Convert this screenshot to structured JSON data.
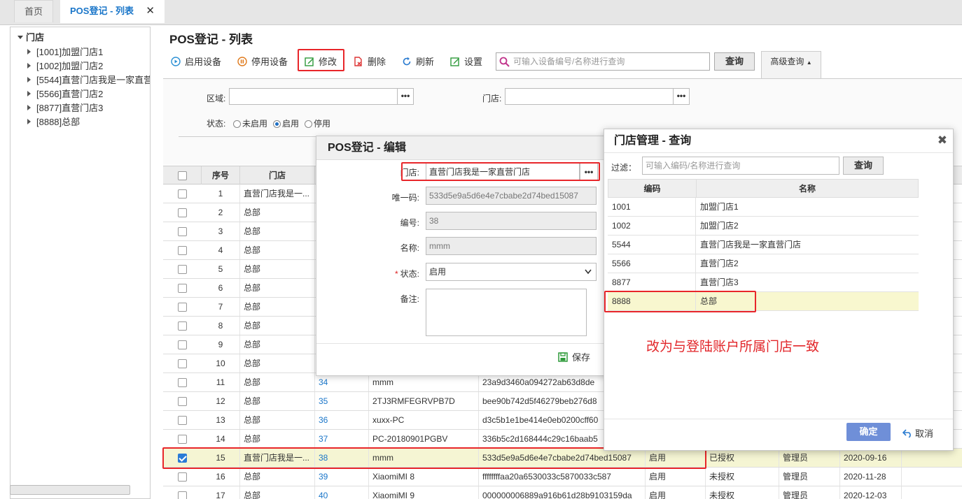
{
  "tabs": {
    "home": "首页",
    "list": "POS登记 - 列表",
    "close": "✕"
  },
  "sidebar": {
    "root": "门店",
    "items": [
      {
        "label": "[1001]加盟门店1"
      },
      {
        "label": "[1002]加盟门店2"
      },
      {
        "label": "[5544]直营门店我是一家直营门店"
      },
      {
        "label": "[5566]直营门店2"
      },
      {
        "label": "[8877]直营门店3"
      },
      {
        "label": "[8888]总部"
      }
    ]
  },
  "page": {
    "title": "POS登记 - 列表"
  },
  "toolbar": {
    "enable": "启用设备",
    "disable": "停用设备",
    "edit": "修改",
    "delete": "删除",
    "refresh": "刷新",
    "settings": "设置",
    "search_placeholder": "可输入设备编号/名称进行查询",
    "search": "查询",
    "advanced": "高级查询"
  },
  "filters": {
    "area_label": "区域:",
    "store_label": "门店:",
    "dots": "•••",
    "status_label": "状态:",
    "status_options": [
      "未启用",
      "启用",
      "停用"
    ]
  },
  "table": {
    "headers": [
      "序号",
      "门店"
    ],
    "rows": [
      {
        "no": "1",
        "store": "直营门店我是一...",
        "id": "",
        "name": "",
        "uid": "",
        "status": "",
        "auth": "",
        "user": "",
        "date": ""
      },
      {
        "no": "2",
        "store": "总部"
      },
      {
        "no": "3",
        "store": "总部"
      },
      {
        "no": "4",
        "store": "总部"
      },
      {
        "no": "5",
        "store": "总部"
      },
      {
        "no": "6",
        "store": "总部"
      },
      {
        "no": "7",
        "store": "总部"
      },
      {
        "no": "8",
        "store": "总部"
      },
      {
        "no": "9",
        "store": "总部"
      },
      {
        "no": "10",
        "store": "总部"
      },
      {
        "no": "11",
        "store": "总部",
        "id": "34",
        "name": "mmm",
        "uid": "23a9d3460a094272ab63d8de"
      },
      {
        "no": "12",
        "store": "总部",
        "id": "35",
        "name": "2TJ3RMFEGRVPB7D",
        "uid": "bee90b742d5f46279beb276d8"
      },
      {
        "no": "13",
        "store": "总部",
        "id": "36",
        "name": "xuxx-PC",
        "uid": "d3c5b1e1be414e0eb0200cff60"
      },
      {
        "no": "14",
        "store": "总部",
        "id": "37",
        "name": "PC-20180901PGBV",
        "uid": "336b5c2d168444c29c16baab5"
      },
      {
        "no": "15",
        "store": "直营门店我是一...",
        "id": "38",
        "name": "mmm",
        "uid": "533d5e9a5d6e4e7cbabe2d74bed15087",
        "status": "启用",
        "auth": "已授权",
        "user": "管理员",
        "date": "2020-09-16"
      },
      {
        "no": "16",
        "store": "总部",
        "id": "39",
        "name": "XiaomiMI 8",
        "uid": "ffffffffaa20a6530033c5870033c587",
        "status": "启用",
        "auth": "未授权",
        "user": "管理员",
        "date": "2020-11-28"
      },
      {
        "no": "17",
        "store": "总部",
        "id": "40",
        "name": "XiaomiMI 9",
        "uid": "000000006889a916b61d28b9103159da",
        "status": "启用",
        "auth": "未授权",
        "user": "管理员",
        "date": "2020-12-03"
      }
    ]
  },
  "edit_dialog": {
    "title": "POS登记 - 编辑",
    "store_label": "门店:",
    "store_value": "直营门店我是一家直营门店",
    "uid_label": "唯一码:",
    "uid_value": "533d5e9a5d6e4e7cbabe2d74bed15087",
    "no_label": "编号:",
    "no_value": "38",
    "name_label": "名称:",
    "name_value": "mmm",
    "status_label": "状态:",
    "status_value": "启用",
    "remark_label": "备注:",
    "save": "保存",
    "required": "*"
  },
  "lookup_dialog": {
    "title": "门店管理 - 查询",
    "close": "✖",
    "filter_label": "过滤：",
    "filter_placeholder": "可输入编码/名称进行查询",
    "search": "查询",
    "col_code": "编码",
    "col_name": "名称",
    "rows": [
      {
        "code": "1001",
        "name": "加盟门店1"
      },
      {
        "code": "1002",
        "name": "加盟门店2"
      },
      {
        "code": "5544",
        "name": "直营门店我是一家直营门店"
      },
      {
        "code": "5566",
        "name": "直营门店2"
      },
      {
        "code": "8877",
        "name": "直营门店3"
      },
      {
        "code": "8888",
        "name": "总部"
      }
    ],
    "annotation": "改为与登陆账户所属门店一致",
    "ok": "确定",
    "cancel": "取消"
  },
  "colors": {
    "accent": "#1a76c9",
    "highlight_box": "#e8262a",
    "ok_button": "#6f8fd8",
    "selected_row": "#f5f5d3"
  }
}
